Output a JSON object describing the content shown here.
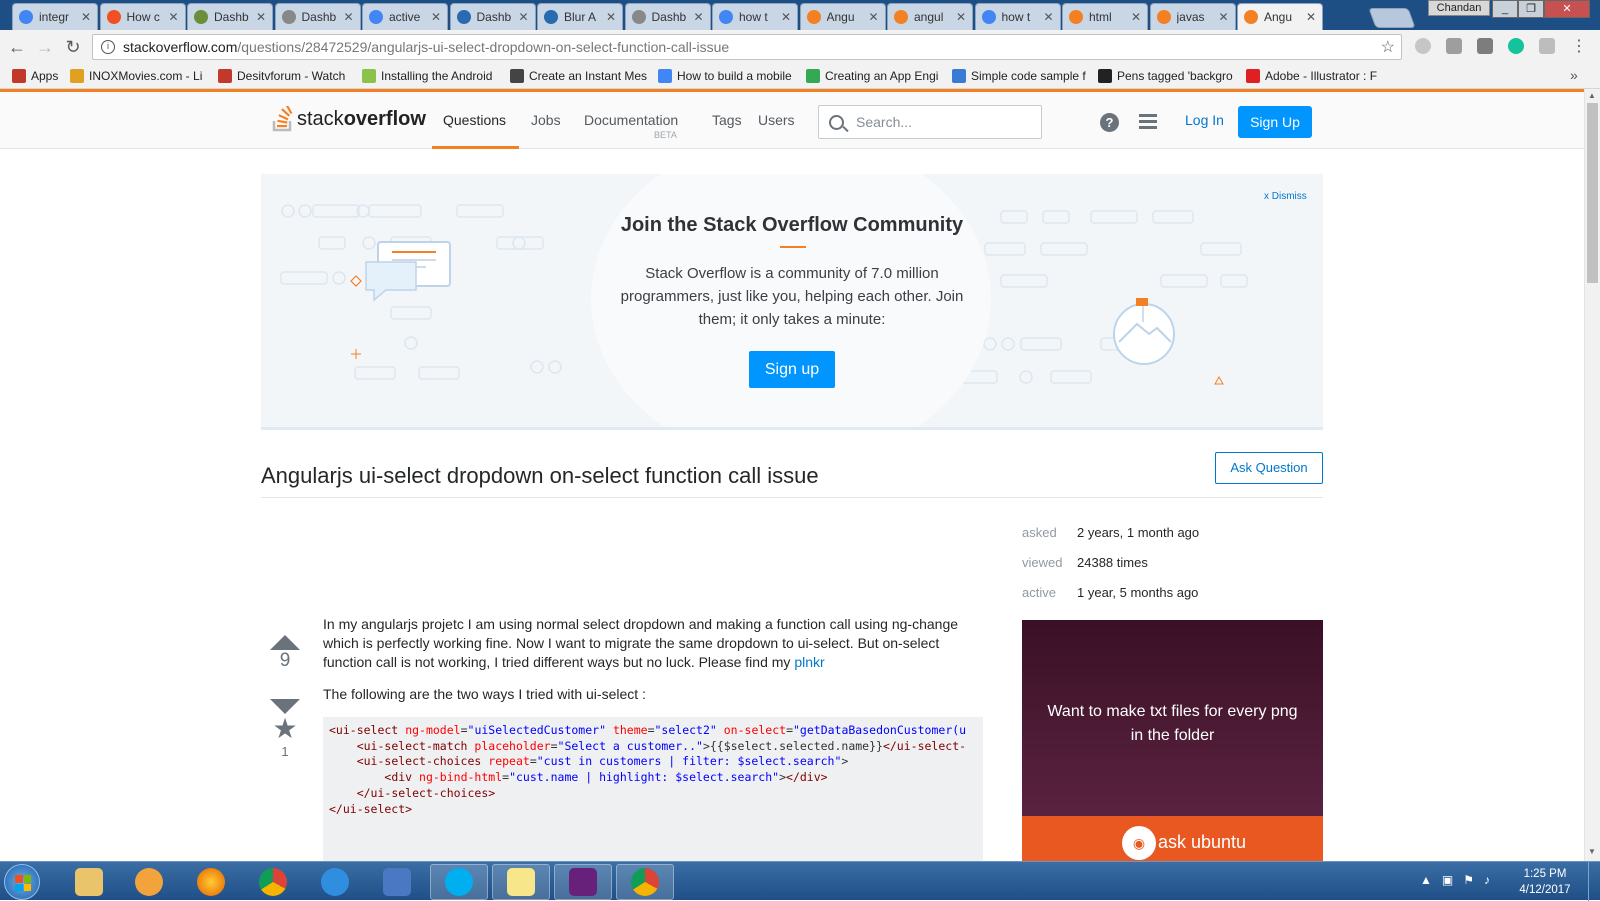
{
  "tabs": [
    {
      "title": "integr",
      "icon": "google-icon",
      "color": "#4285f4"
    },
    {
      "title": "How c",
      "icon": "microsoft-icon",
      "color": "#f25022"
    },
    {
      "title": "Dashb",
      "icon": "dashboard-icon",
      "color": "#6a8f3a"
    },
    {
      "title": "Dashb",
      "icon": "document-icon",
      "color": "#888888"
    },
    {
      "title": "active",
      "icon": "google-icon",
      "color": "#4285f4"
    },
    {
      "title": "Dashb",
      "icon": "dashboard-icon",
      "color": "#2a6ab0"
    },
    {
      "title": "Blur A",
      "icon": "chart-icon",
      "color": "#2a6ab0"
    },
    {
      "title": "Dashb",
      "icon": "document-icon",
      "color": "#888888"
    },
    {
      "title": "how t",
      "icon": "google-icon",
      "color": "#4285f4"
    },
    {
      "title": "Angu",
      "icon": "stackoverflow-icon",
      "color": "#f48024"
    },
    {
      "title": "angul",
      "icon": "stackoverflow-icon",
      "color": "#f48024"
    },
    {
      "title": "how t",
      "icon": "google-icon",
      "color": "#4285f4"
    },
    {
      "title": "html",
      "icon": "stackoverflow-icon",
      "color": "#f48024"
    },
    {
      "title": "javas",
      "icon": "stackoverflow-icon",
      "color": "#f48024"
    },
    {
      "title": "Angu",
      "icon": "stackoverflow-icon",
      "color": "#f48024"
    }
  ],
  "window": {
    "profile": "Chandan"
  },
  "url": {
    "host": "stackoverflow.com",
    "path": "/questions/28472529/angularjs-ui-select-dropdown-on-select-function-call-issue"
  },
  "bookmarks": [
    {
      "label": "Apps",
      "icon": "apps-grid-icon",
      "color": "#c0392b"
    },
    {
      "label": "INOXMovies.com - Li",
      "icon": "globe-icon",
      "color": "#e0a020"
    },
    {
      "label": "Desitvforum - Watch",
      "icon": "desitv-icon",
      "color": "#c0392b"
    },
    {
      "label": "Installing the Android",
      "icon": "android-icon",
      "color": "#8bc34a"
    },
    {
      "label": "Create an Instant Mes",
      "icon": "bookmark-icon",
      "color": "#444444"
    },
    {
      "label": "How to build a mobile",
      "icon": "google-icon",
      "color": "#4285f4"
    },
    {
      "label": "Creating an App Engi",
      "icon": "appengine-icon",
      "color": "#34a853"
    },
    {
      "label": "Simple code sample f",
      "icon": "grid-icon",
      "color": "#3a7bd5"
    },
    {
      "label": "Pens tagged 'backgro",
      "icon": "codepen-icon",
      "color": "#222222"
    },
    {
      "label": "Adobe - Illustrator : F",
      "icon": "adobe-icon",
      "color": "#e02020"
    }
  ],
  "so": {
    "logo_light": "stack",
    "logo_bold": "overflow",
    "nav": {
      "questions": "Questions",
      "jobs": "Jobs",
      "documentation": "Documentation",
      "beta": "BETA",
      "tags": "Tags",
      "users": "Users"
    },
    "search_placeholder": "Search...",
    "login": "Log In",
    "signup": "Sign Up"
  },
  "hero": {
    "dismiss": "x Dismiss",
    "title": "Join the Stack Overflow Community",
    "text": "Stack Overflow is a community of 7.0 million programmers, just like you, helping each other. Join them; it only takes a minute:",
    "signup": "Sign up"
  },
  "question": {
    "title": "Angularjs ui-select dropdown on-select function call issue",
    "ask_button": "Ask Question",
    "meta": [
      {
        "label": "asked",
        "value": "2 years, 1 month ago"
      },
      {
        "label": "viewed",
        "value": "24388 times"
      },
      {
        "label": "active",
        "value": "1 year, 5 months ago"
      }
    ],
    "votes": "9",
    "favorites": "1",
    "body1": "In my angularjs projetc I am using normal select dropdown and making a function call using ng-change which is perfectly working fine. Now I want to migrate the same dropdown to ui-select. But on-select function call is not working, I tried different ways but no luck. Please find my ",
    "body1_link": "plnkr",
    "body2": "The following are the two ways I tried with ui-select :"
  },
  "ad": {
    "text": "Want to make txt files for every png in the folder",
    "brand": "ask ubuntu"
  },
  "taskbar": {
    "time": "1:25 PM",
    "date": "4/12/2017"
  }
}
